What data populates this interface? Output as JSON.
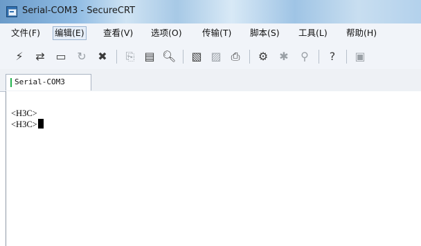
{
  "window": {
    "title": "Serial-COM3 - SecureCRT"
  },
  "menu": {
    "items": [
      "文件(F)",
      "编辑(E)",
      "查看(V)",
      "选项(O)",
      "传输(T)",
      "脚本(S)",
      "工具(L)",
      "帮助(H)"
    ],
    "active_index": 1
  },
  "toolbar": {
    "icons": [
      "connect-icon",
      "quick-connect-icon",
      "connect-tab-icon",
      "reconnect-icon",
      "disconnect-icon",
      "copy-icon",
      "paste-icon",
      "find-icon",
      "print-setup-icon",
      "print-selection-icon",
      "print-icon",
      "session-options-icon",
      "global-options-icon",
      "keymap-icon",
      "help-icon",
      "sftp-icon"
    ]
  },
  "tabs": [
    {
      "label": "Serial-COM3",
      "status_color": "#22b14c"
    }
  ],
  "terminal": {
    "lines": [
      "<H3C>",
      "<H3C>"
    ]
  }
}
